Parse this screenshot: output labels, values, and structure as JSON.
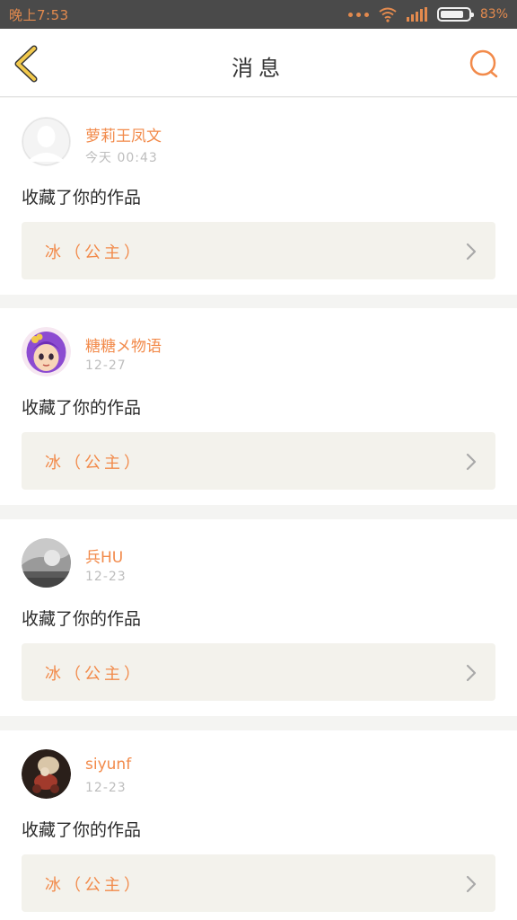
{
  "status": {
    "time": "晚上7:53",
    "battery_percent_label": "83%",
    "battery_level": 0.83,
    "icons": [
      "more-dots-icon",
      "wifi-icon",
      "signal-icon",
      "battery-icon"
    ]
  },
  "header": {
    "title": "消息",
    "back_icon": "chevron-left-icon",
    "search_icon": "search-icon"
  },
  "colors": {
    "accent": "#f28a4a",
    "back_icon": "#f2c94c",
    "status_bar": "#4a4a4a",
    "card_link_bg": "#f3f2ec"
  },
  "messages": [
    {
      "username": "萝莉王凤文",
      "time": "今天 00:43",
      "action": "收藏了你的作品",
      "work": "冰（公主）",
      "avatar": "default-avatar"
    },
    {
      "username": "糖糖メ物语",
      "time": "12-27",
      "action": "收藏了你的作品",
      "work": "冰（公主）",
      "avatar": "cartoon-girl-avatar"
    },
    {
      "username": "兵HU",
      "time": "12-23",
      "action": "收藏了你的作品",
      "work": "冰（公主）",
      "avatar": "gray-photo-avatar"
    },
    {
      "username": "siyunf",
      "time": "12-23",
      "action": "收藏了你的作品",
      "work": "冰（公主）",
      "avatar": "photo-avatar"
    }
  ]
}
